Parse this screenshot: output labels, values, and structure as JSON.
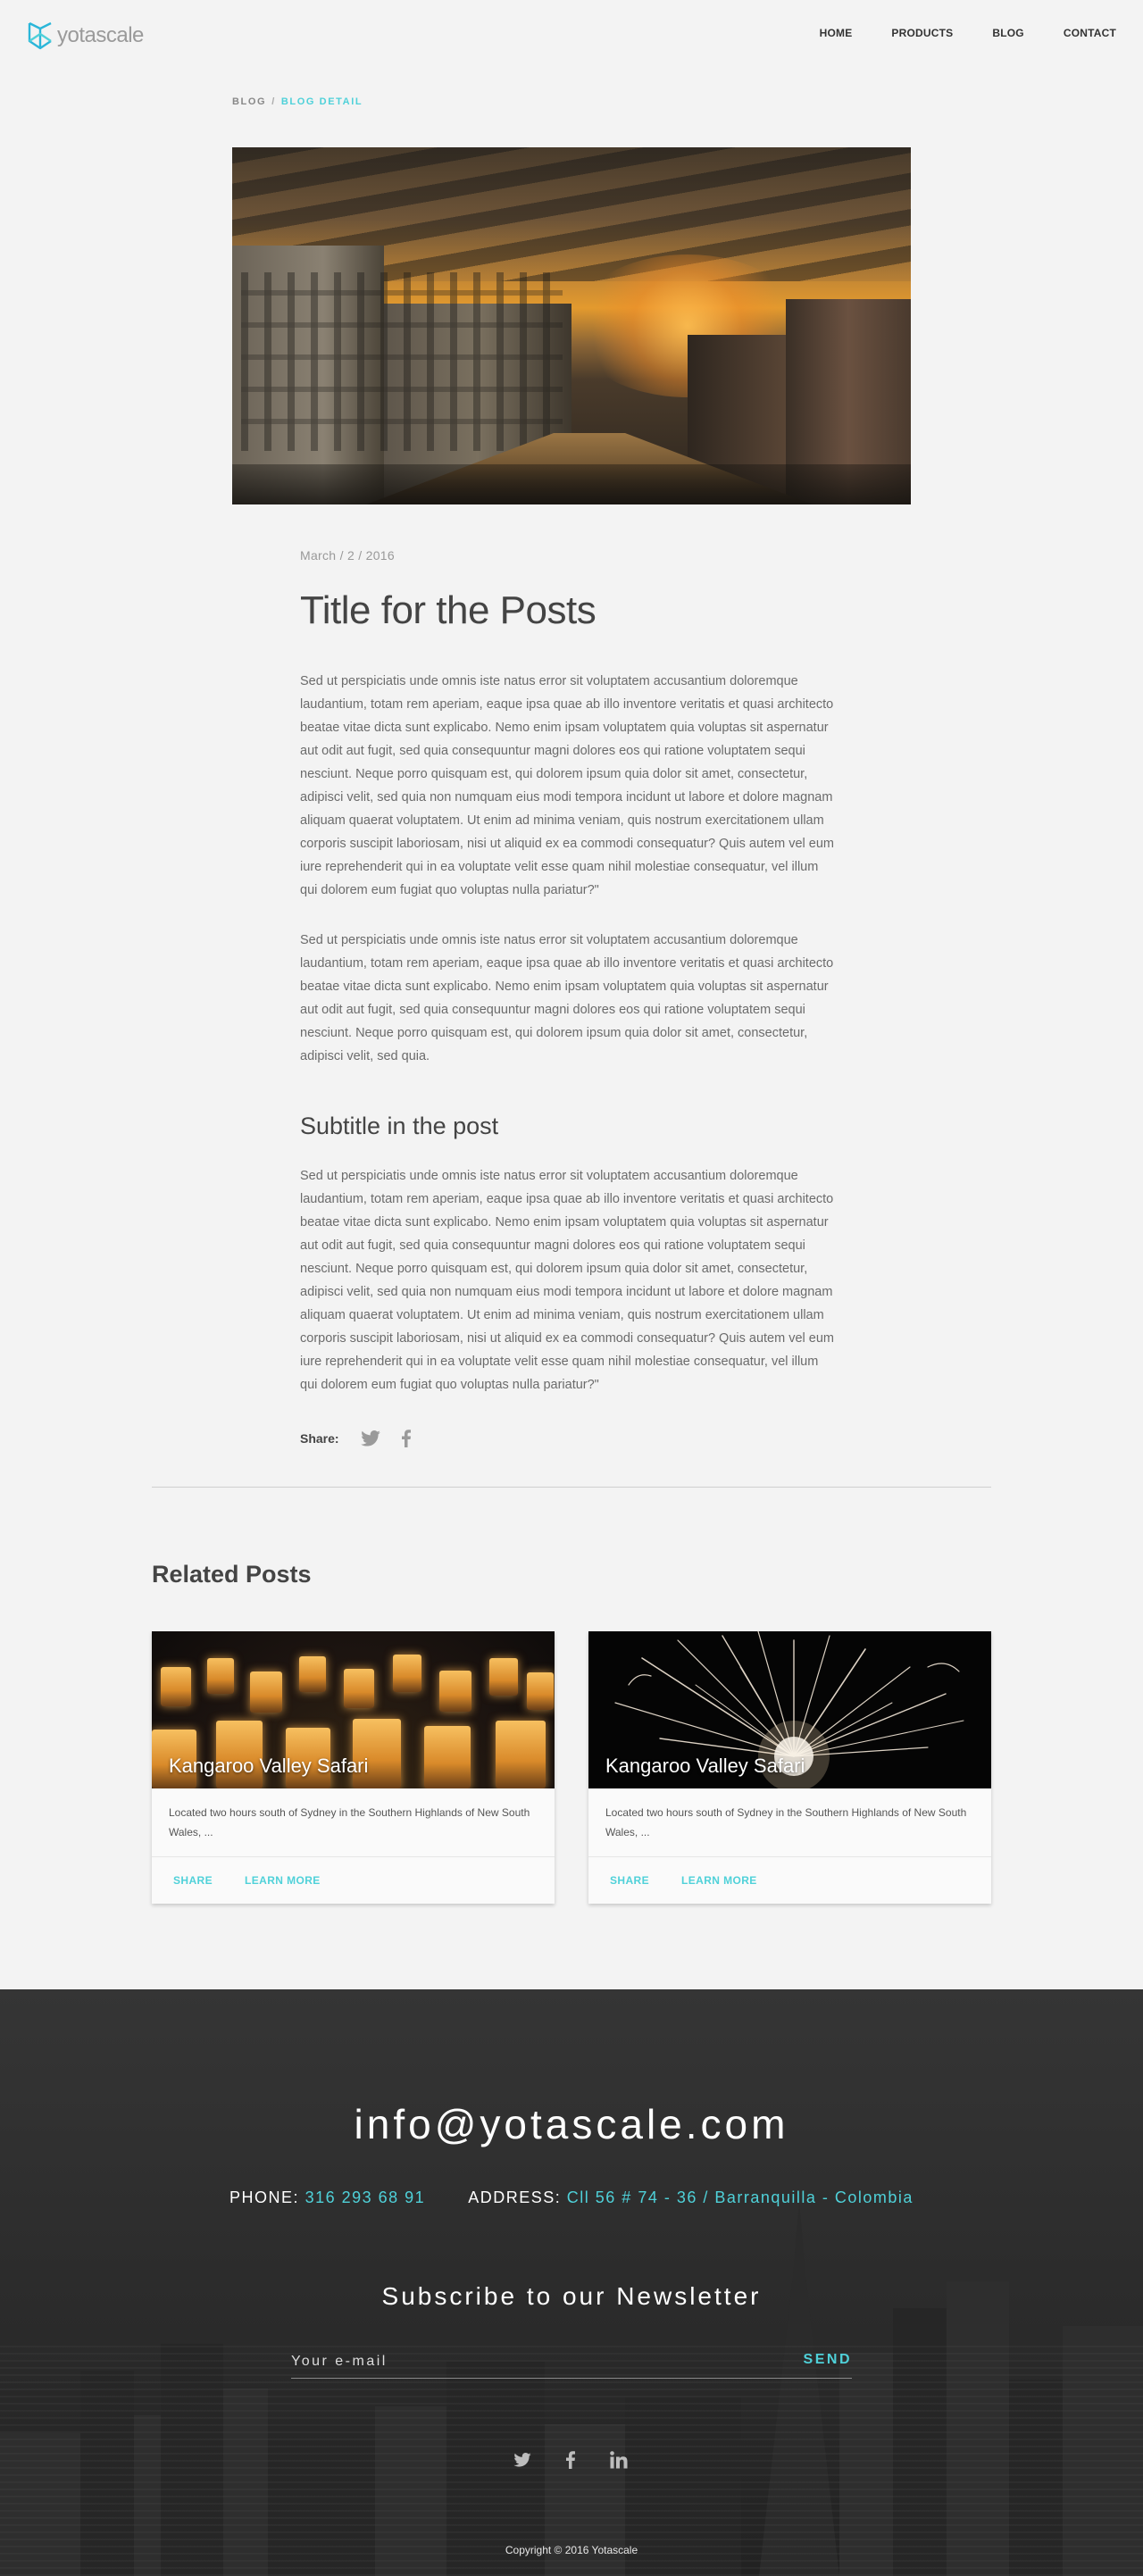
{
  "header": {
    "logo_text": "yotascale",
    "nav": [
      "HOME",
      "PRODUCTS",
      "BLOG",
      "CONTACT"
    ]
  },
  "breadcrumb": {
    "home": "BLOG",
    "separator": "/",
    "current": "BLOG DETAIL"
  },
  "post": {
    "date": "March / 2 /  2016",
    "title": "Title for the Posts",
    "paragraph_1": "Sed ut perspiciatis unde omnis iste natus error sit voluptatem accusantium doloremque laudantium, totam rem aperiam, eaque ipsa quae ab illo inventore veritatis et quasi architecto beatae vitae dicta sunt explicabo. Nemo enim ipsam voluptatem quia voluptas sit aspernatur aut odit aut fugit, sed quia consequuntur magni dolores eos qui ratione voluptatem sequi nesciunt. Neque porro quisquam est, qui dolorem ipsum quia dolor sit amet, consectetur, adipisci velit, sed quia non numquam eius modi tempora incidunt ut labore et dolore magnam aliquam quaerat voluptatem. Ut enim ad minima veniam, quis nostrum exercitationem ullam corporis suscipit laboriosam, nisi ut aliquid ex ea commodi consequatur? Quis autem vel eum iure reprehenderit qui in ea voluptate velit esse quam nihil molestiae consequatur, vel illum qui dolorem eum fugiat quo voluptas nulla pariatur?\"",
    "paragraph_2": "Sed ut perspiciatis unde omnis iste natus error sit voluptatem accusantium doloremque laudantium, totam rem aperiam, eaque ipsa quae ab illo inventore veritatis et quasi architecto beatae vitae dicta sunt explicabo. Nemo enim ipsam voluptatem quia voluptas sit aspernatur aut odit aut fugit, sed quia consequuntur magni dolores eos qui ratione voluptatem sequi nesciunt. Neque porro quisquam est, qui dolorem ipsum quia dolor sit amet, consectetur, adipisci velit, sed quia.",
    "subtitle": "Subtitle in the post",
    "paragraph_3": "Sed ut perspiciatis unde omnis iste natus error sit voluptatem accusantium doloremque laudantium, totam rem aperiam, eaque ipsa quae ab illo inventore veritatis et quasi architecto beatae vitae dicta sunt explicabo. Nemo enim ipsam voluptatem quia voluptas sit aspernatur aut odit aut fugit, sed quia consequuntur magni dolores eos qui ratione voluptatem sequi nesciunt. Neque porro quisquam est, qui dolorem ipsum quia dolor sit amet, consectetur, adipisci velit, sed quia non numquam eius modi tempora incidunt ut labore et dolore magnam aliquam quaerat voluptatem. Ut enim ad minima veniam, quis nostrum exercitationem ullam corporis suscipit laboriosam, nisi ut aliquid ex ea commodi consequatur? Quis autem vel eum iure reprehenderit qui in ea voluptate velit esse quam nihil molestiae consequatur, vel illum qui dolorem eum fugiat quo voluptas nulla pariatur?\"",
    "share_label": "Share:",
    "share_icons": [
      "twitter-icon",
      "facebook-icon"
    ]
  },
  "related": {
    "title": "Related Posts",
    "cards": [
      {
        "title": "Kangaroo Valley Safari",
        "description": "Located two hours south of Sydney in the Southern Highlands of New South Wales, ...",
        "share_label": "SHARE",
        "more_label": "LEARN MORE"
      },
      {
        "title": "Kangaroo Valley Safari",
        "description": "Located two hours south of Sydney in the Southern Highlands of New South Wales, ...",
        "share_label": "SHARE",
        "more_label": "LEARN MORE"
      }
    ]
  },
  "footer": {
    "email": "info@yotascale.com",
    "phone_label": "PHONE:",
    "phone": "316 293 68 91",
    "address_label": "ADDRESS:",
    "address": "Cll 56 # 74 - 36 / Barranquilla - Colombia",
    "newsletter_title": "Subscribe to our Newsletter",
    "email_placeholder": "Your e-mail",
    "send_label": "SEND",
    "social_icons": [
      "twitter-icon",
      "facebook-icon",
      "linkedin-icon"
    ],
    "copyright": "Copyright © 2016 Yotascale"
  },
  "colors": {
    "accent": "#4fd1d9",
    "text_dark": "#444444",
    "background": "#f3f3f3",
    "footer_bg": "#2a2a2a"
  }
}
